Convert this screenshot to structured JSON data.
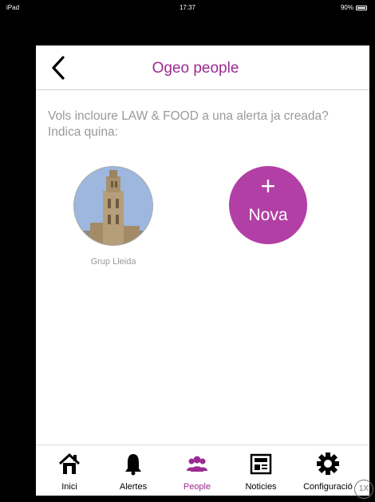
{
  "status_bar": {
    "device": "iPad",
    "time": "17:37",
    "battery": "90%"
  },
  "header": {
    "title": "Ogeo people",
    "back_icon": "chevron-left-icon"
  },
  "prompt": "Vols incloure LAW & FOOD a una alerta ja creada? Indica quina:",
  "groups": [
    {
      "label": "Grup Lleida"
    }
  ],
  "new_alert": {
    "plus": "+",
    "label": "Nova"
  },
  "colors": {
    "accent": "#9c2a91",
    "nova_bg": "#b23fa6"
  },
  "tabs": [
    {
      "label": "Inici",
      "icon": "home-icon"
    },
    {
      "label": "Alertes",
      "icon": "bell-icon"
    },
    {
      "label": "People",
      "icon": "people-icon",
      "active": true
    },
    {
      "label": "Noticies",
      "icon": "newspaper-icon"
    },
    {
      "label": "Configuració",
      "icon": "gear-icon"
    }
  ],
  "zoom_badge": "1X"
}
